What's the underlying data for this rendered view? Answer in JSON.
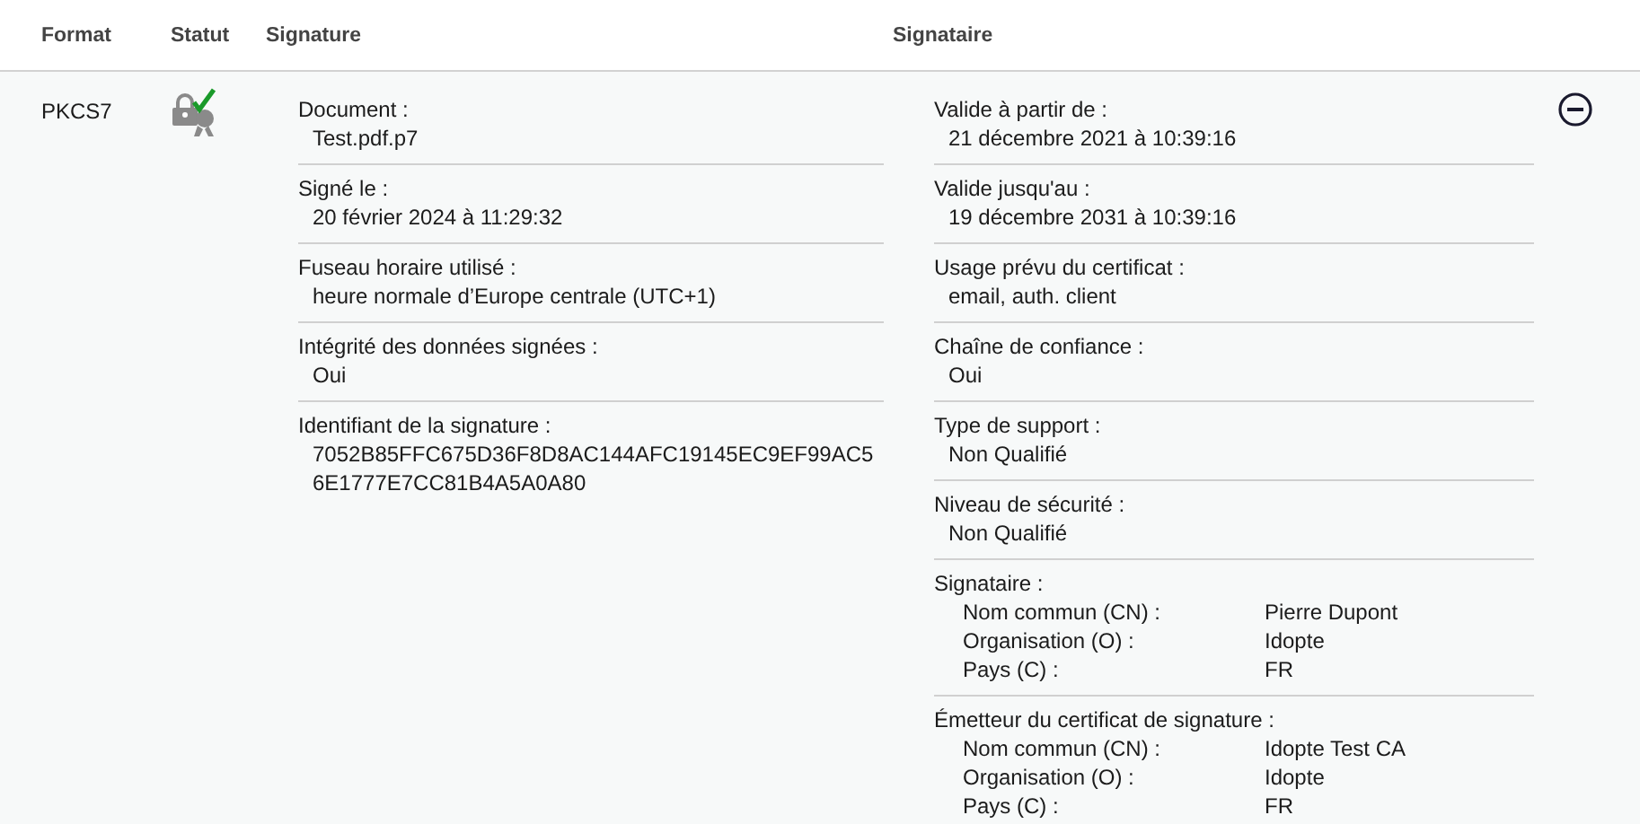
{
  "table": {
    "columns": [
      "Format",
      "Statut",
      "Signature",
      "Signataire"
    ],
    "rows": [
      {
        "format": "PKCS7",
        "valid": true,
        "expanded": true,
        "signature": [
          {
            "label": "Document :",
            "value": "Test.pdf.p7"
          },
          {
            "label": "Signé le :",
            "value": "20 février 2024 à 11:29:32"
          },
          {
            "label": "Fuseau horaire utilisé :",
            "value": "heure normale d’Europe centrale (UTC+1)"
          },
          {
            "label": "Intégrité des données signées :",
            "value": "Oui"
          },
          {
            "label": "Identifiant de la signature :",
            "value": "7052B85FFC675D36F8D8AC144AFC19145EC9EF99AC56E1777E7CC81B4A5A0A80"
          }
        ],
        "signer": [
          {
            "label": "Valide à partir de :",
            "value": "21 décembre 2021 à 10:39:16"
          },
          {
            "label": "Valide jusqu'au :",
            "value": "19 décembre 2031 à 10:39:16"
          },
          {
            "label": "Usage prévu du certificat :",
            "value": "email, auth. client"
          },
          {
            "label": "Chaîne de confiance :",
            "value": "Oui"
          },
          {
            "label": "Type de support :",
            "value": "Non Qualifié"
          },
          {
            "label": "Niveau de sécurité :",
            "value": "Non Qualifié"
          },
          {
            "label": "Signataire :",
            "pairs": [
              {
                "name": "Nom commun (CN) :",
                "value": "Pierre Dupont"
              },
              {
                "name": "Organisation (O) :",
                "value": "Idopte"
              },
              {
                "name": "Pays (C) :",
                "value": "FR"
              }
            ]
          },
          {
            "label": "Émetteur du certificat de signature :",
            "pairs": [
              {
                "name": "Nom commun (CN) :",
                "value": "Idopte Test CA"
              },
              {
                "name": "Organisation (O) :",
                "value": "Idopte"
              },
              {
                "name": "Pays (C) :",
                "value": "FR"
              }
            ]
          }
        ]
      }
    ]
  }
}
